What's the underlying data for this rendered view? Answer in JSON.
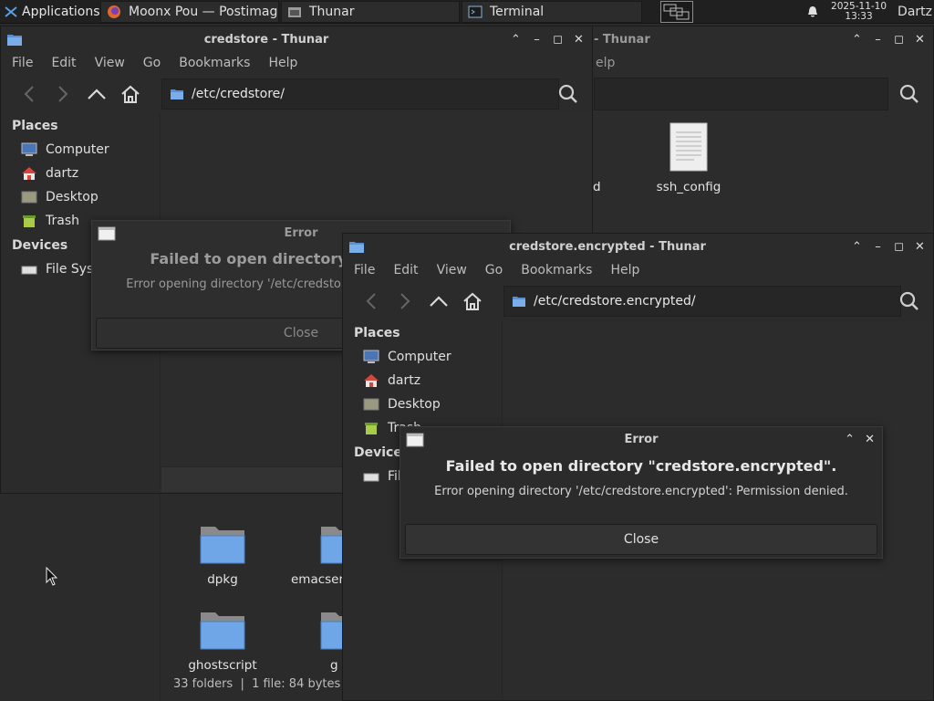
{
  "panel": {
    "apps_label": "Applications",
    "tasks": [
      {
        "label": "Moonx Pou — Postimag...",
        "icon": "firefox-icon"
      },
      {
        "label": "Thunar",
        "icon": "file-manager-icon"
      },
      {
        "label": "Terminal",
        "icon": "terminal-icon"
      }
    ],
    "clock_date": "2025-11-10",
    "clock_time": "13:33",
    "user": "Dartz"
  },
  "menu": [
    "File",
    "Edit",
    "View",
    "Go",
    "Bookmarks",
    "Help"
  ],
  "back_window": {
    "title_fragment": "- Thunar",
    "menu_fragment": "elp",
    "file_label": "ssh_config",
    "partial_label": "d"
  },
  "credstore_window": {
    "title": "credstore - Thunar",
    "path": "/etc/credstore/",
    "places_heading": "Places",
    "places": [
      "Computer",
      "dartz",
      "Desktop",
      "Trash"
    ],
    "devices_heading": "Devices",
    "devices": [
      "File System"
    ],
    "folders": [
      "dpkg",
      "emacsen-common",
      "ghostscript",
      "g"
    ],
    "status": "33 folders  |  1 file: 84 bytes"
  },
  "dialog1": {
    "title": "Error",
    "heading": "Failed to open directory \"credstore\".",
    "message": "Error opening directory '/etc/credstore': Permission denied.",
    "button": "Close"
  },
  "encrypted_window": {
    "title": "credstore.encrypted - Thunar",
    "path": "/etc/credstore.encrypted/",
    "places_heading": "Places",
    "places": [
      "Computer",
      "dartz",
      "Desktop",
      "Trash"
    ],
    "devices_heading": "Devices",
    "devices": [
      "File System"
    ]
  },
  "dialog2": {
    "title": "Error",
    "heading": "Failed to open directory \"credstore.encrypted\".",
    "message": "Error opening directory '/etc/credstore.encrypted': Permission denied.",
    "button": "Close"
  }
}
